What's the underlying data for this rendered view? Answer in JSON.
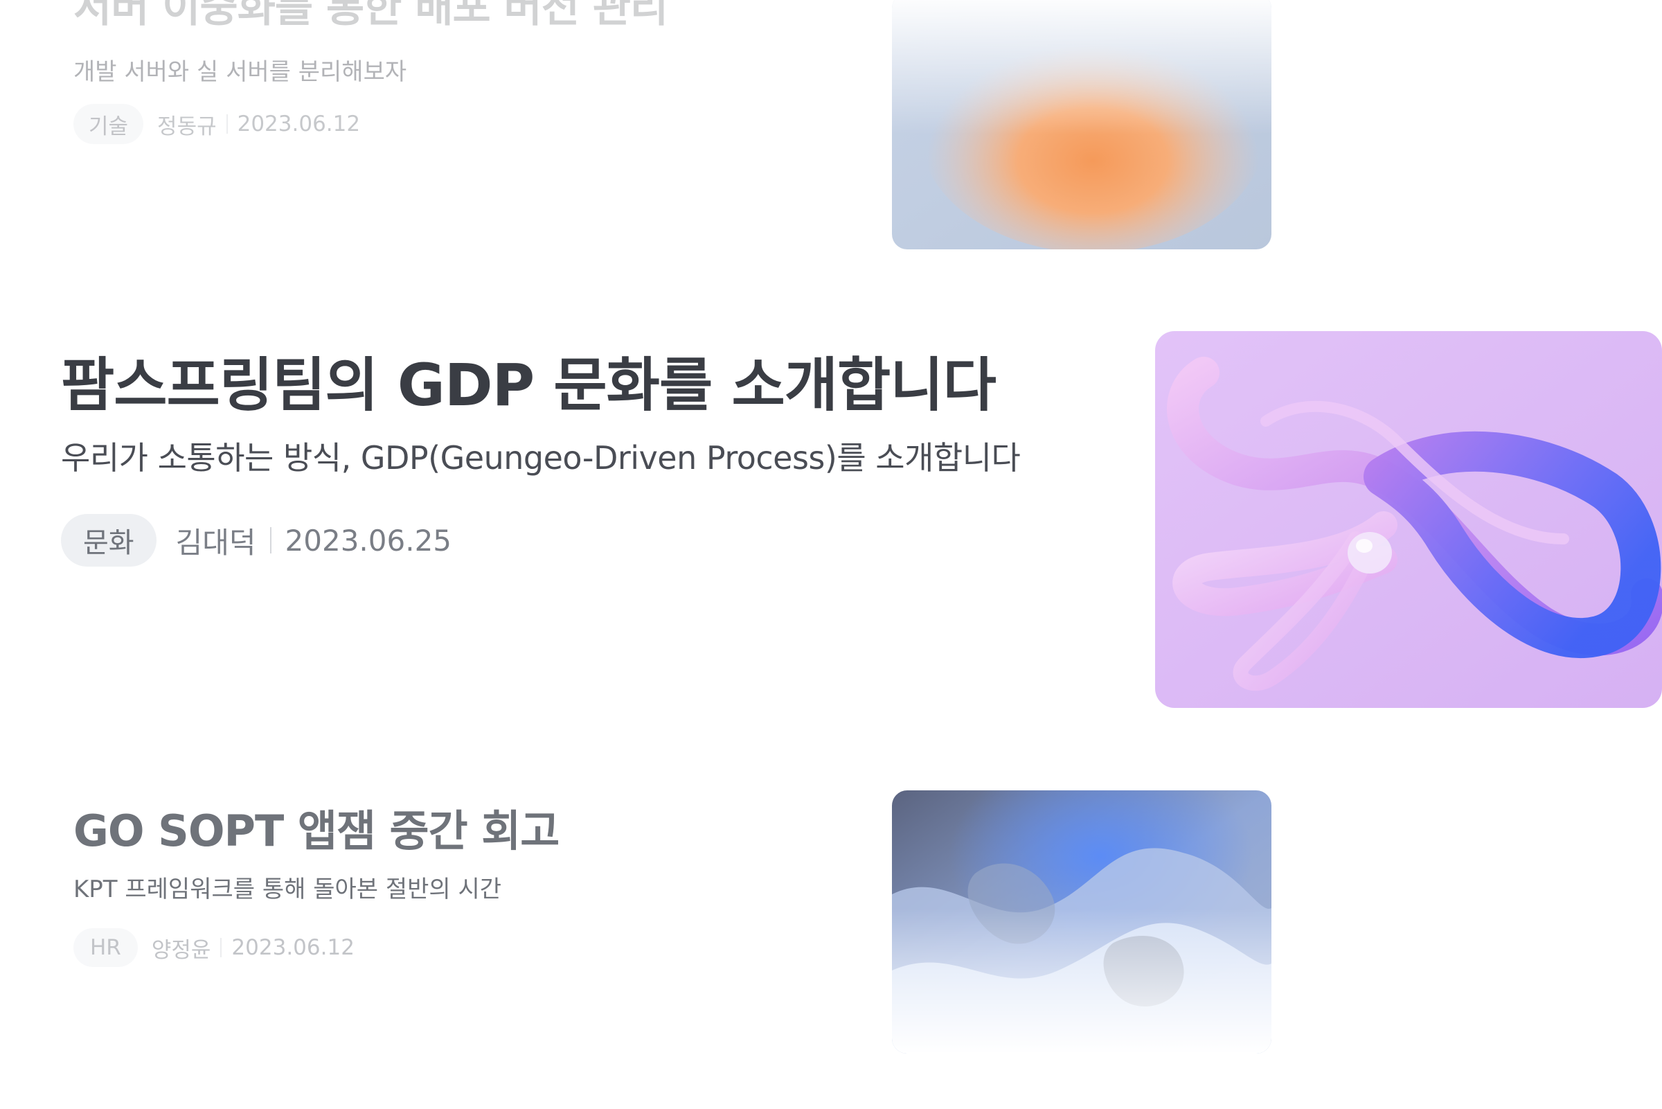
{
  "posts": [
    {
      "title": "서버 이중화를 통한 배포 버전 관리",
      "subtitle": "개발 서버와 실 서버를 분리해보자",
      "tag": "기술",
      "author": "정동규",
      "date": "2023.06.12"
    },
    {
      "title": "팜스프링팀의 GDP 문화를 소개합니다",
      "subtitle": "우리가 소통하는 방식, GDP(Geungeo-Driven Process)를 소개합니다",
      "tag": "문화",
      "author": "김대덕",
      "date": "2023.06.25"
    },
    {
      "title": "GO SOPT 앱잼 중간 회고",
      "subtitle": "KPT 프레임워크를 통해 돌아본 절반의 시간",
      "tag": "HR",
      "author": "양정윤",
      "date": "2023.06.12"
    }
  ],
  "colors": {
    "title": "#3a3d44",
    "subtitle": "#4a4d55",
    "meta": "#8a8e96",
    "tag_bg": "#eef0f3",
    "accent_purple": "#d9b8f5",
    "accent_blue": "#4a6cf7"
  }
}
